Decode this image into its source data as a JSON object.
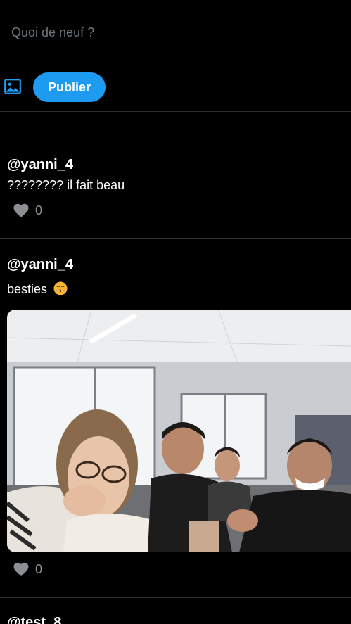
{
  "composer": {
    "placeholder": "Quoi de neuf ?",
    "publish_label": "Publier"
  },
  "icons": {
    "media": "image-icon",
    "like": "heart-icon"
  },
  "colors": {
    "accent": "#1d9bf0",
    "background": "#000000",
    "muted": "#8b8f94"
  },
  "posts": [
    {
      "username": "@yanni_4",
      "text": "???????? il fait beau",
      "likes": "0"
    },
    {
      "username": "@yanni_4",
      "text": "besties",
      "emoji": "kissing-face-emoji",
      "has_image": true,
      "likes": "0"
    },
    {
      "username": "@test_8"
    }
  ]
}
